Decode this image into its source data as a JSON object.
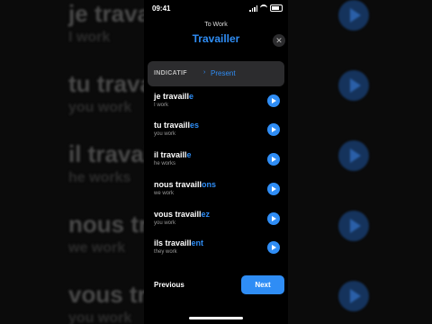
{
  "status": {
    "time": "09:41"
  },
  "header": {
    "subtitle": "To Work",
    "title": "Travailler",
    "close_icon": "close-icon"
  },
  "tense": {
    "mood": "INDICATIF",
    "tense": "Present"
  },
  "conjugations": [
    {
      "stem": "je travaill",
      "ending": "e",
      "translation": "I work"
    },
    {
      "stem": "tu travaill",
      "ending": "es",
      "translation": "you work"
    },
    {
      "stem": "il travaill",
      "ending": "e",
      "translation": "he works"
    },
    {
      "stem": "nous travaill",
      "ending": "ons",
      "translation": "we work"
    },
    {
      "stem": "vous travaill",
      "ending": "ez",
      "translation": "you work"
    },
    {
      "stem": "ils travaill",
      "ending": "ent",
      "translation": "they work"
    }
  ],
  "footer": {
    "previous_label": "Previous",
    "next_label": "Next"
  },
  "background_left": [
    {
      "fr": "je travaille",
      "en": "I work"
    },
    {
      "fr": "tu travailles",
      "en": "you work"
    },
    {
      "fr": "il travaille",
      "en": "he works"
    },
    {
      "fr": "nous travaillons",
      "en": "we work"
    },
    {
      "fr": "vous travaillez",
      "en": "you work"
    }
  ],
  "colors": {
    "accent": "#2f8df5",
    "panel": "#2c2c2e",
    "background": "#000000"
  }
}
